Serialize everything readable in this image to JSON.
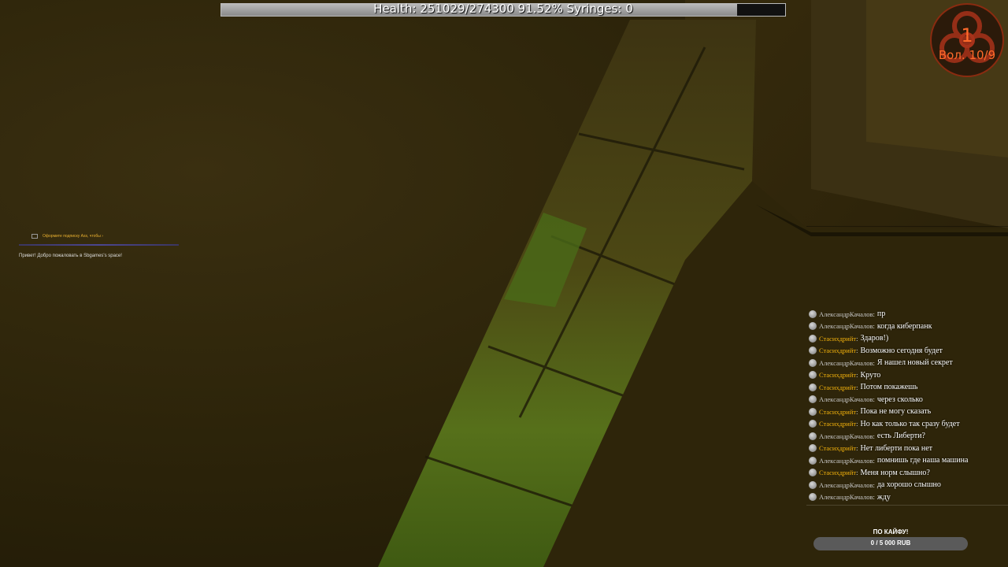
{
  "hud": {
    "health_text": "Health: 251029/274300 91.52% Syringes: 0",
    "health_fraction": 0.9152,
    "health_fill_color": "#a9a9a9"
  },
  "wave": {
    "icon": "biohazard-icon",
    "number": "1",
    "label": "Вол. 10/9",
    "color": "#ff6a2a"
  },
  "overlay_left": {
    "sub_notice": "Оформите подписку Ass, чтобы ›",
    "welcome": "Привет! Добро пожаловать в Sbgames's space!"
  },
  "chat": {
    "messages": [
      {
        "user": "АлександрКачалов",
        "text": "пр",
        "color": "#c8c8c8"
      },
      {
        "user": "АлександрКачалов",
        "text": "когда киберпанк",
        "color": "#c8c8c8"
      },
      {
        "user": "Стасихдрийт",
        "text": "Здаров!)",
        "color": "#f2b10c"
      },
      {
        "user": "Стасихдрийт",
        "text": "Возможно сегодня будет",
        "color": "#f2b10c"
      },
      {
        "user": "АлександрКачалов",
        "text": "Я нашел новый секрет",
        "color": "#c8c8c8"
      },
      {
        "user": "Стасихдрийт",
        "text": "Круто",
        "color": "#f2b10c"
      },
      {
        "user": "Стасихдрийт",
        "text": "Потом покажешь",
        "color": "#f2b10c"
      },
      {
        "user": "АлександрКачалов",
        "text": "через сколько",
        "color": "#c8c8c8"
      },
      {
        "user": "Стасихдрийт",
        "text": "Пока не могу сказать",
        "color": "#f2b10c"
      },
      {
        "user": "Стасихдрийт",
        "text": "Но как только так сразу будет",
        "color": "#f2b10c"
      },
      {
        "user": "АлександрКачалов",
        "text": "есть Либерти?",
        "color": "#c8c8c8"
      },
      {
        "user": "Стасихдрийт",
        "text": "Нет либерти пока нет",
        "color": "#f2b10c"
      },
      {
        "user": "АлександрКачалов",
        "text": "помнишь где наша машина",
        "color": "#c8c8c8"
      },
      {
        "user": "Стасихдрийт",
        "text": "Меня норм слышно?",
        "color": "#f2b10c"
      },
      {
        "user": "АлександрКачалов",
        "text": "да хорошо слышно",
        "color": "#c8c8c8"
      },
      {
        "user": "АлександрКачалов",
        "text": "жду",
        "color": "#c8c8c8"
      }
    ]
  },
  "donation_goal": {
    "title": "ПО КАЙФУ!",
    "progress": "0 / 5 000 RUB",
    "fraction": 0
  }
}
